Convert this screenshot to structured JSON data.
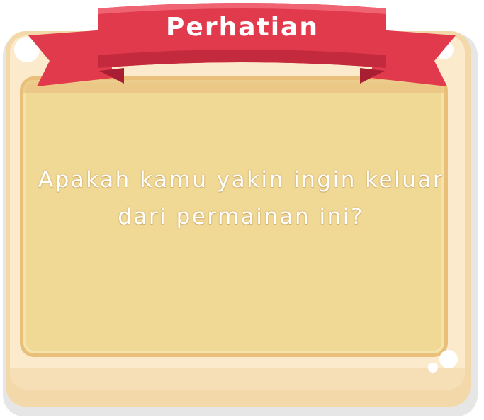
{
  "dialog": {
    "title": "Perhatian",
    "message": "Apakah kamu yakin ingin keluar dari permainan ini?"
  },
  "colors": {
    "ribbon": "#e23a4d",
    "ribbon_dark": "#c42a3e",
    "panel": "#f0d895",
    "frame": "#fbeacb",
    "text": "#ffffff"
  }
}
